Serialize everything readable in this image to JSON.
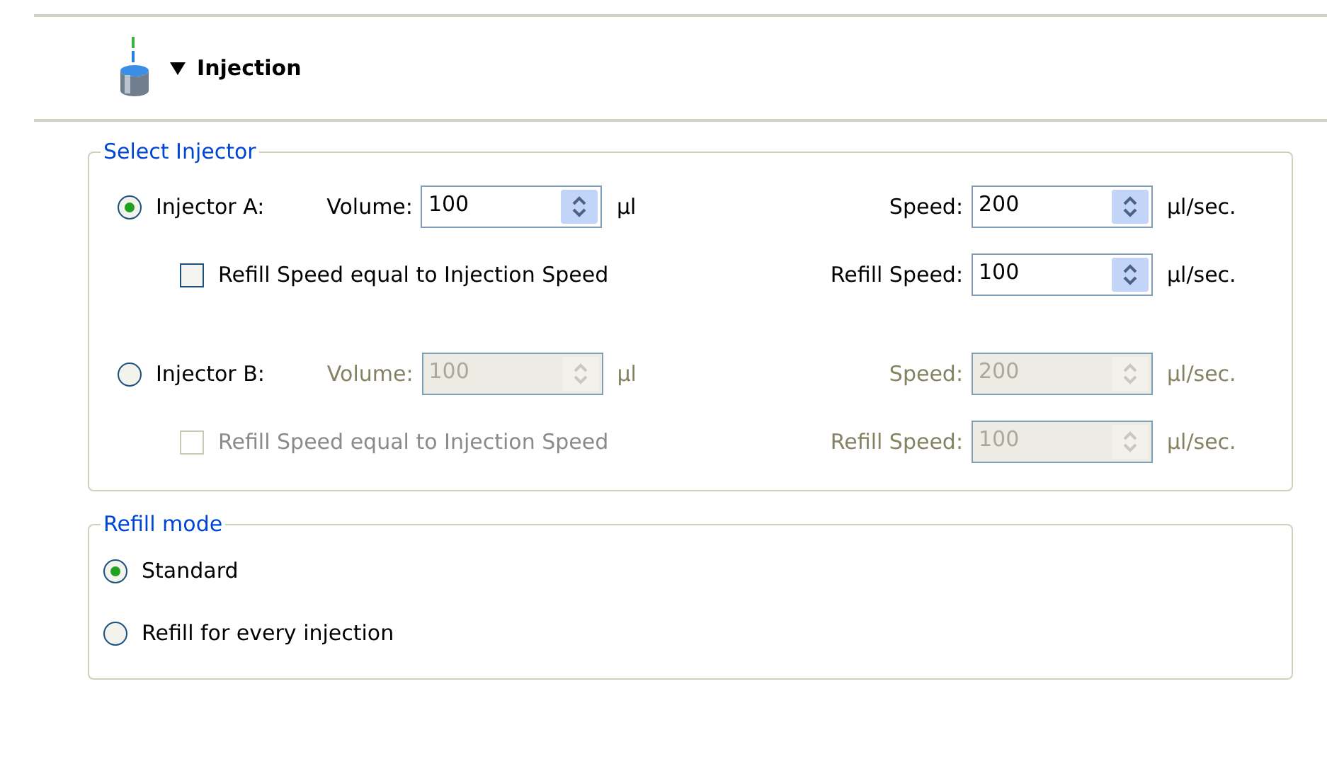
{
  "section": {
    "title": "Injection",
    "expanded": true
  },
  "select_injector": {
    "title": "Select Injector",
    "injectors": [
      {
        "label": "Injector A:",
        "selected": true,
        "disabled": false,
        "volume": {
          "label": "Volume:",
          "value": "100",
          "unit": "µl"
        },
        "speed": {
          "label": "Speed:",
          "value": "200",
          "unit": "µl/sec."
        },
        "refill_equal": {
          "label": "Refill Speed equal to Injection Speed",
          "checked": false
        },
        "refill_speed": {
          "label": "Refill Speed:",
          "value": "100",
          "unit": "µl/sec."
        }
      },
      {
        "label": "Injector B:",
        "selected": false,
        "disabled": true,
        "volume": {
          "label": "Volume:",
          "value": "100",
          "unit": "µl"
        },
        "speed": {
          "label": "Speed:",
          "value": "200",
          "unit": "µl/sec."
        },
        "refill_equal": {
          "label": "Refill Speed equal to Injection Speed",
          "checked": false
        },
        "refill_speed": {
          "label": "Refill Speed:",
          "value": "100",
          "unit": "µl/sec."
        }
      }
    ]
  },
  "refill_mode": {
    "title": "Refill mode",
    "options": [
      {
        "label": "Standard",
        "selected": true
      },
      {
        "label": "Refill for every injection",
        "selected": false
      }
    ]
  }
}
